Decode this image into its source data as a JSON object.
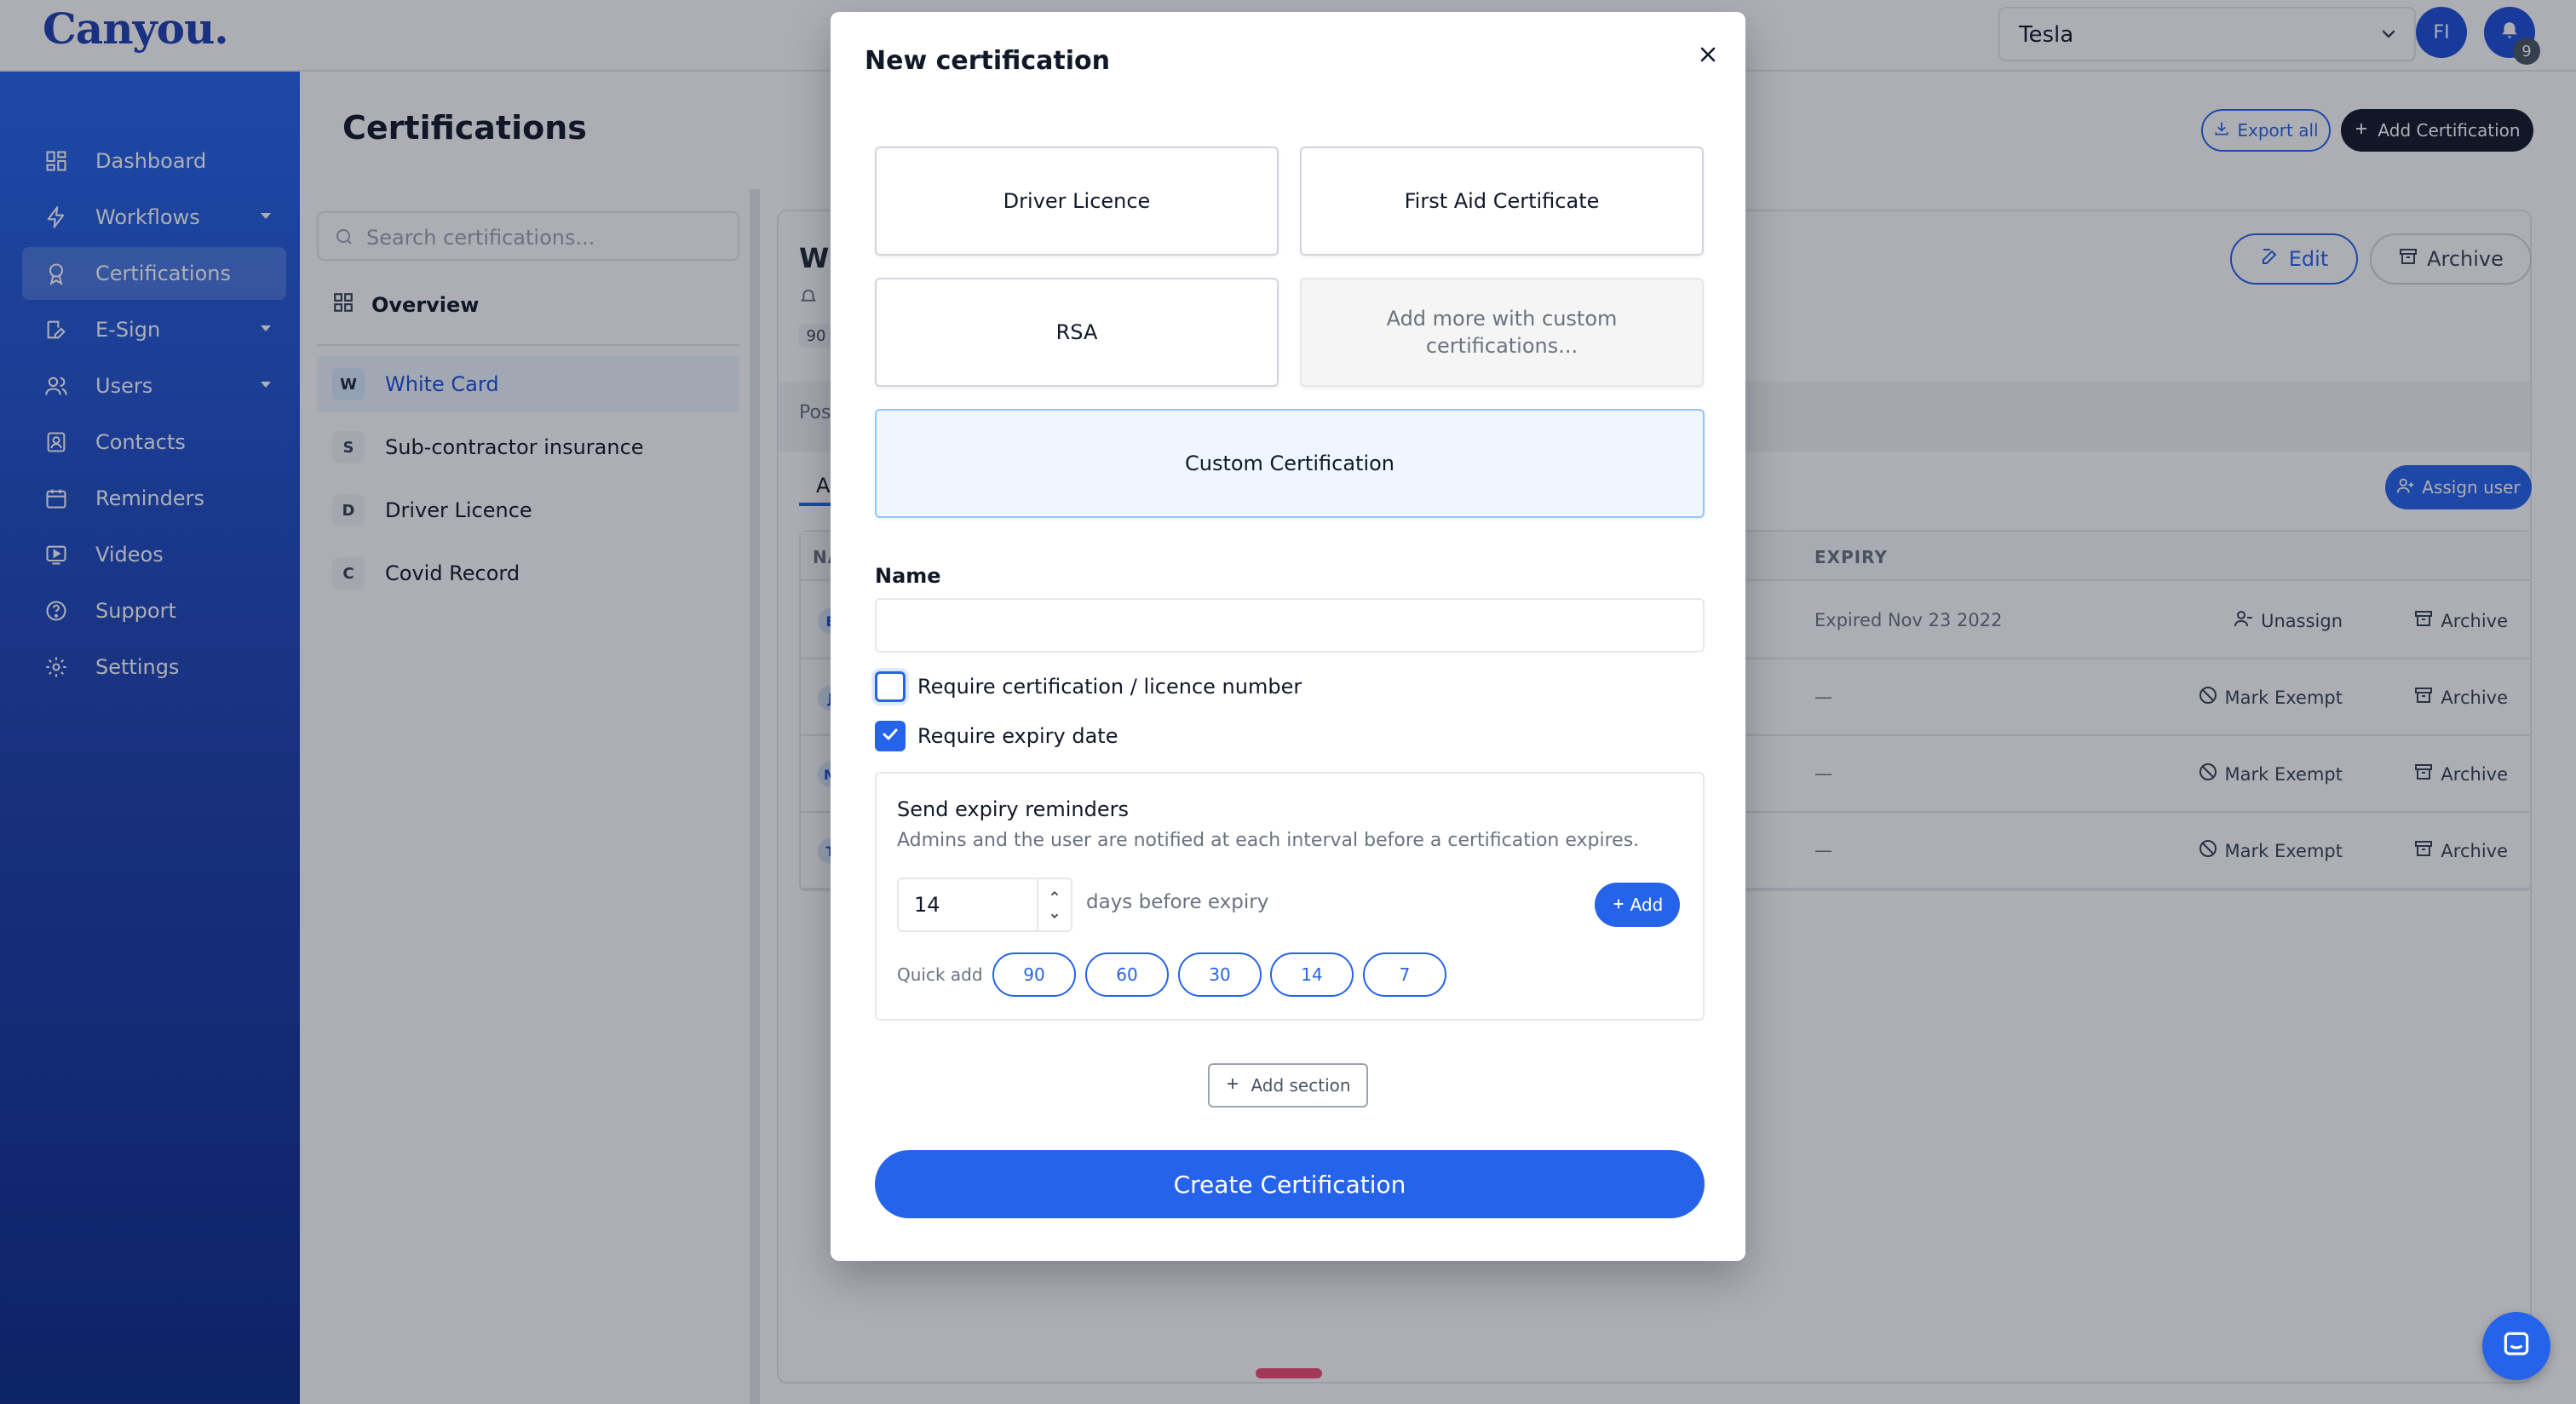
{
  "app": {
    "logo_text": "Canyou.",
    "org_selector_value": "Tesla",
    "user_initials": "FI",
    "notification_count": "9",
    "brand_color": "#2563eb"
  },
  "sidebar": {
    "items": [
      {
        "label": "Dashboard",
        "icon": "dashboard-icon"
      },
      {
        "label": "Workflows",
        "icon": "lightning-icon"
      },
      {
        "label": "Certifications",
        "icon": "award-icon"
      },
      {
        "label": "E-Sign",
        "icon": "signature-icon"
      },
      {
        "label": "Users",
        "icon": "users-icon"
      },
      {
        "label": "Contacts",
        "icon": "contacts-icon"
      },
      {
        "label": "Reminders",
        "icon": "calendar-icon"
      },
      {
        "label": "Videos",
        "icon": "video-icon"
      },
      {
        "label": "Support",
        "icon": "help-icon"
      },
      {
        "label": "Settings",
        "icon": "gear-icon"
      }
    ],
    "active_index": 2
  },
  "page": {
    "title": "Certifications",
    "export_label": "Export all",
    "add_label": "Add Certification"
  },
  "list": {
    "search_placeholder": "Search certifications...",
    "overview_label": "Overview",
    "items": [
      {
        "letter": "W",
        "label": "White Card"
      },
      {
        "letter": "S",
        "label": "Sub-contractor insurance"
      },
      {
        "letter": "D",
        "label": "Driver Licence"
      },
      {
        "letter": "C",
        "label": "Covid Record"
      }
    ]
  },
  "detail": {
    "title_partial": "W",
    "edit_label": "Edit",
    "archive_label": "Archive",
    "sub_badge_partial": "90",
    "band_text_partial": "Pos",
    "tab_partial": "A",
    "assign_label": "Assign user",
    "col_name_partial": "NA",
    "col_expiry": "EXPIRY",
    "rows": [
      {
        "initial": "E",
        "expiry": "Expired Nov 23 2022",
        "action1": "Unassign",
        "action2": "Archive"
      },
      {
        "initial": "J",
        "expiry": "—",
        "action1": "Mark Exempt",
        "action2": "Archive"
      },
      {
        "initial": "M",
        "expiry": "—",
        "action1": "Mark Exempt",
        "action2": "Archive"
      },
      {
        "initial": "T",
        "expiry": "—",
        "action1": "Mark Exempt",
        "action2": "Archive"
      }
    ]
  },
  "modal": {
    "title": "New certification",
    "presets": {
      "driver": "Driver Licence",
      "first_aid": "First Aid Certificate",
      "rsa": "RSA",
      "more_line1": "Add more with custom",
      "more_line2": "certifications...",
      "custom": "Custom Certification"
    },
    "name_label": "Name",
    "name_value": "",
    "require_number_label": "Require certification / licence number",
    "require_number_checked": false,
    "require_expiry_label": "Require expiry date",
    "require_expiry_checked": true,
    "reminders": {
      "title": "Send expiry reminders",
      "description": "Admins and the user are notified at each interval before a certification expires.",
      "days_value": "14",
      "days_suffix": "days before expiry",
      "add_label": "Add",
      "quick_add_label": "Quick add",
      "quick_values": [
        "90",
        "60",
        "30",
        "14",
        "7"
      ]
    },
    "add_section_label": "Add section",
    "create_label": "Create Certification"
  }
}
